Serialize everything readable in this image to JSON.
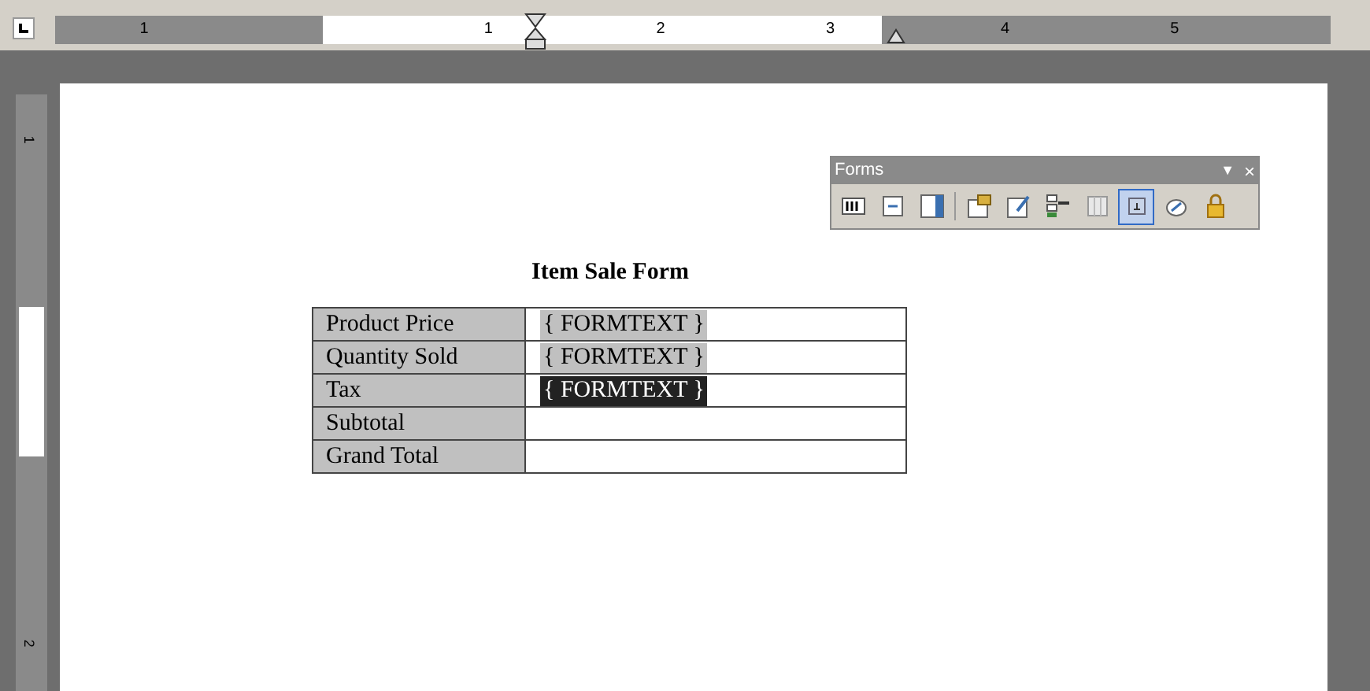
{
  "ruler": {
    "labels": [
      "1",
      "1",
      "2",
      "3",
      "4",
      "5"
    ]
  },
  "vertical_ruler": {
    "labels": [
      "1",
      "2"
    ]
  },
  "forms_toolbar": {
    "title": "Forms",
    "menu": "▼",
    "close": "×",
    "buttons": [
      {
        "kind": "textfield",
        "selected": false
      },
      {
        "kind": "checkbox",
        "selected": false
      },
      {
        "kind": "dropdown",
        "selected": false
      },
      {
        "kind": "properties",
        "selected": false
      },
      {
        "kind": "drawtable",
        "selected": false
      },
      {
        "kind": "inserttable",
        "selected": false
      },
      {
        "kind": "frame",
        "selected": false
      },
      {
        "kind": "shading",
        "selected": true
      },
      {
        "kind": "reset",
        "selected": false
      },
      {
        "kind": "lock",
        "selected": false
      }
    ]
  },
  "document": {
    "title": "Item Sale Form",
    "rows": [
      {
        "label": "Product Price",
        "field": "{ FORMTEXT }",
        "selected": false
      },
      {
        "label": "Quantity Sold",
        "field": "{ FORMTEXT }",
        "selected": false
      },
      {
        "label": "Tax",
        "field": "{ FORMTEXT }",
        "selected": true
      },
      {
        "label": "Subtotal"
      },
      {
        "label": "Grand Total"
      }
    ]
  }
}
